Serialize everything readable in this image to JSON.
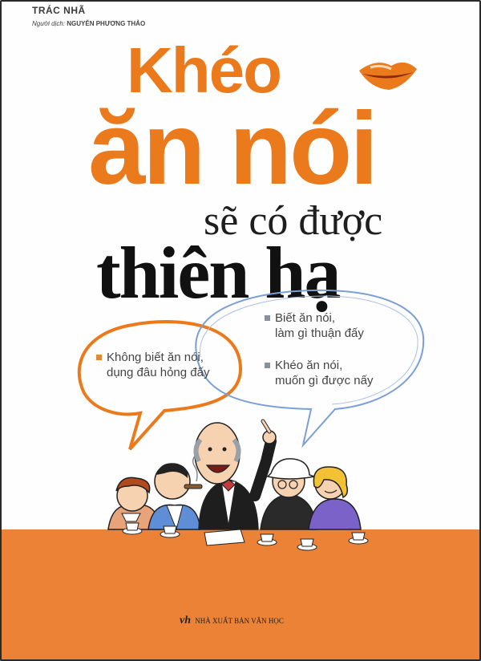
{
  "book": {
    "author": "TRÁC NHÃ",
    "translator_label": "Người dịch:",
    "translator_name": "NGUYỄN PHƯƠNG THẢO",
    "title_line1": "Khéo",
    "title_line2": "ăn nói",
    "subtitle_line1": "sẽ có được",
    "subtitle_line2": "thiên hạ"
  },
  "bubbles": {
    "left": {
      "line1": "Không biết ăn nói,",
      "line2": "dụng đâu hỏng đấy"
    },
    "right1": {
      "line1": "Biết ăn nói,",
      "line2": "làm gì thuận đấy"
    },
    "right2": {
      "line1": "Khéo ăn nói,",
      "line2": "muốn gì được nấy"
    }
  },
  "publisher": {
    "logo": "vh",
    "name": "NHÀ XUẤT BẢN VĂN HỌC"
  },
  "colors": {
    "accent": "#ea7a1c",
    "band": "#ec8235",
    "bubble_blue": "#7a9fd6",
    "title_dark": "#111111"
  },
  "icons": {
    "lips": "lips-icon",
    "illustration": "people-at-table-illustration"
  }
}
